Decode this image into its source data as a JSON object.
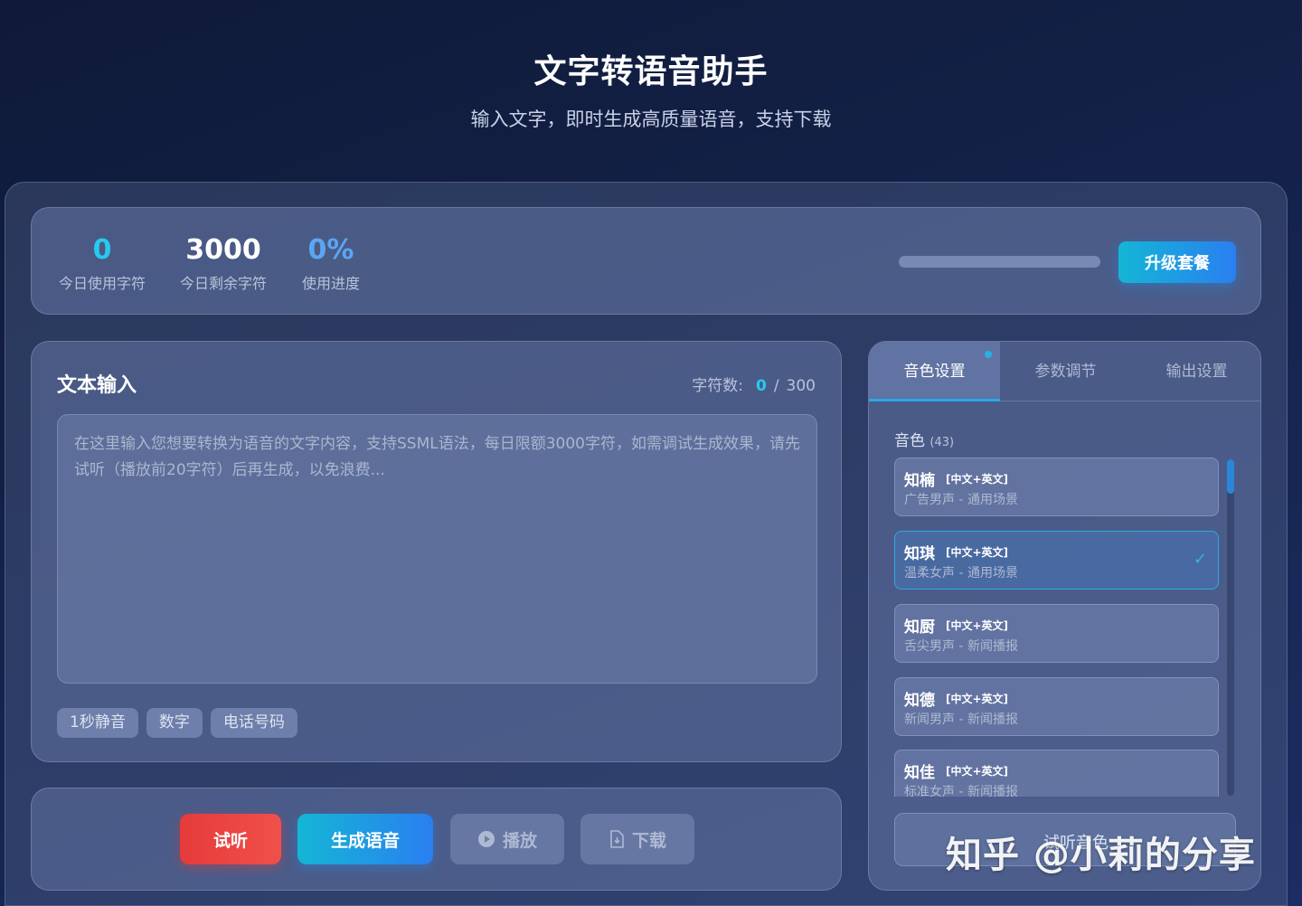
{
  "header": {
    "title": "文字转语音助手",
    "subtitle": "输入文字，即时生成高质量语音，支持下载"
  },
  "stats": {
    "used_value": "0",
    "used_label": "今日使用字符",
    "remaining_value": "3000",
    "remaining_label": "今日剩余字符",
    "progress_value": "0%",
    "progress_label": "使用进度",
    "progress_fraction": 0,
    "upgrade_label": "升级套餐"
  },
  "text_input": {
    "title": "文本输入",
    "count_label": "字符数:",
    "count_current": "0",
    "count_separator": "/",
    "count_max": "300",
    "placeholder": "在这里输入您想要转换为语音的文字内容，支持SSML语法，每日限额3000字符，如需调试生成效果，请先试听（播放前20字符）后再生成，以免浪费...",
    "chips": [
      "1秒静音",
      "数字",
      "电话号码"
    ]
  },
  "actions": {
    "listen_label": "试听",
    "generate_label": "生成语音",
    "play_label": "播放",
    "download_label": "下载"
  },
  "settings": {
    "tabs": [
      "音色设置",
      "参数调节",
      "输出设置"
    ],
    "active_tab": 0,
    "voice_label": "音色",
    "voice_count": "(43)",
    "voices": [
      {
        "name": "知楠",
        "tag": "[中文+英文]",
        "desc": "广告男声 - 通用场景",
        "selected": false
      },
      {
        "name": "知琪",
        "tag": "[中文+英文]",
        "desc": "温柔女声 - 通用场景",
        "selected": true
      },
      {
        "name": "知厨",
        "tag": "[中文+英文]",
        "desc": "舌尖男声 - 新闻播报",
        "selected": false
      },
      {
        "name": "知德",
        "tag": "[中文+英文]",
        "desc": "新闻男声 - 新闻播报",
        "selected": false
      },
      {
        "name": "知佳",
        "tag": "[中文+英文]",
        "desc": "标准女声 - 新闻播报",
        "selected": false
      }
    ],
    "preview_label": "试听音色"
  },
  "watermark": "知乎 @小莉的分享",
  "colors": {
    "accent_cyan": "#29c9ee",
    "accent_blue": "#2a7ff0",
    "listen_red": "#e53b3b"
  }
}
